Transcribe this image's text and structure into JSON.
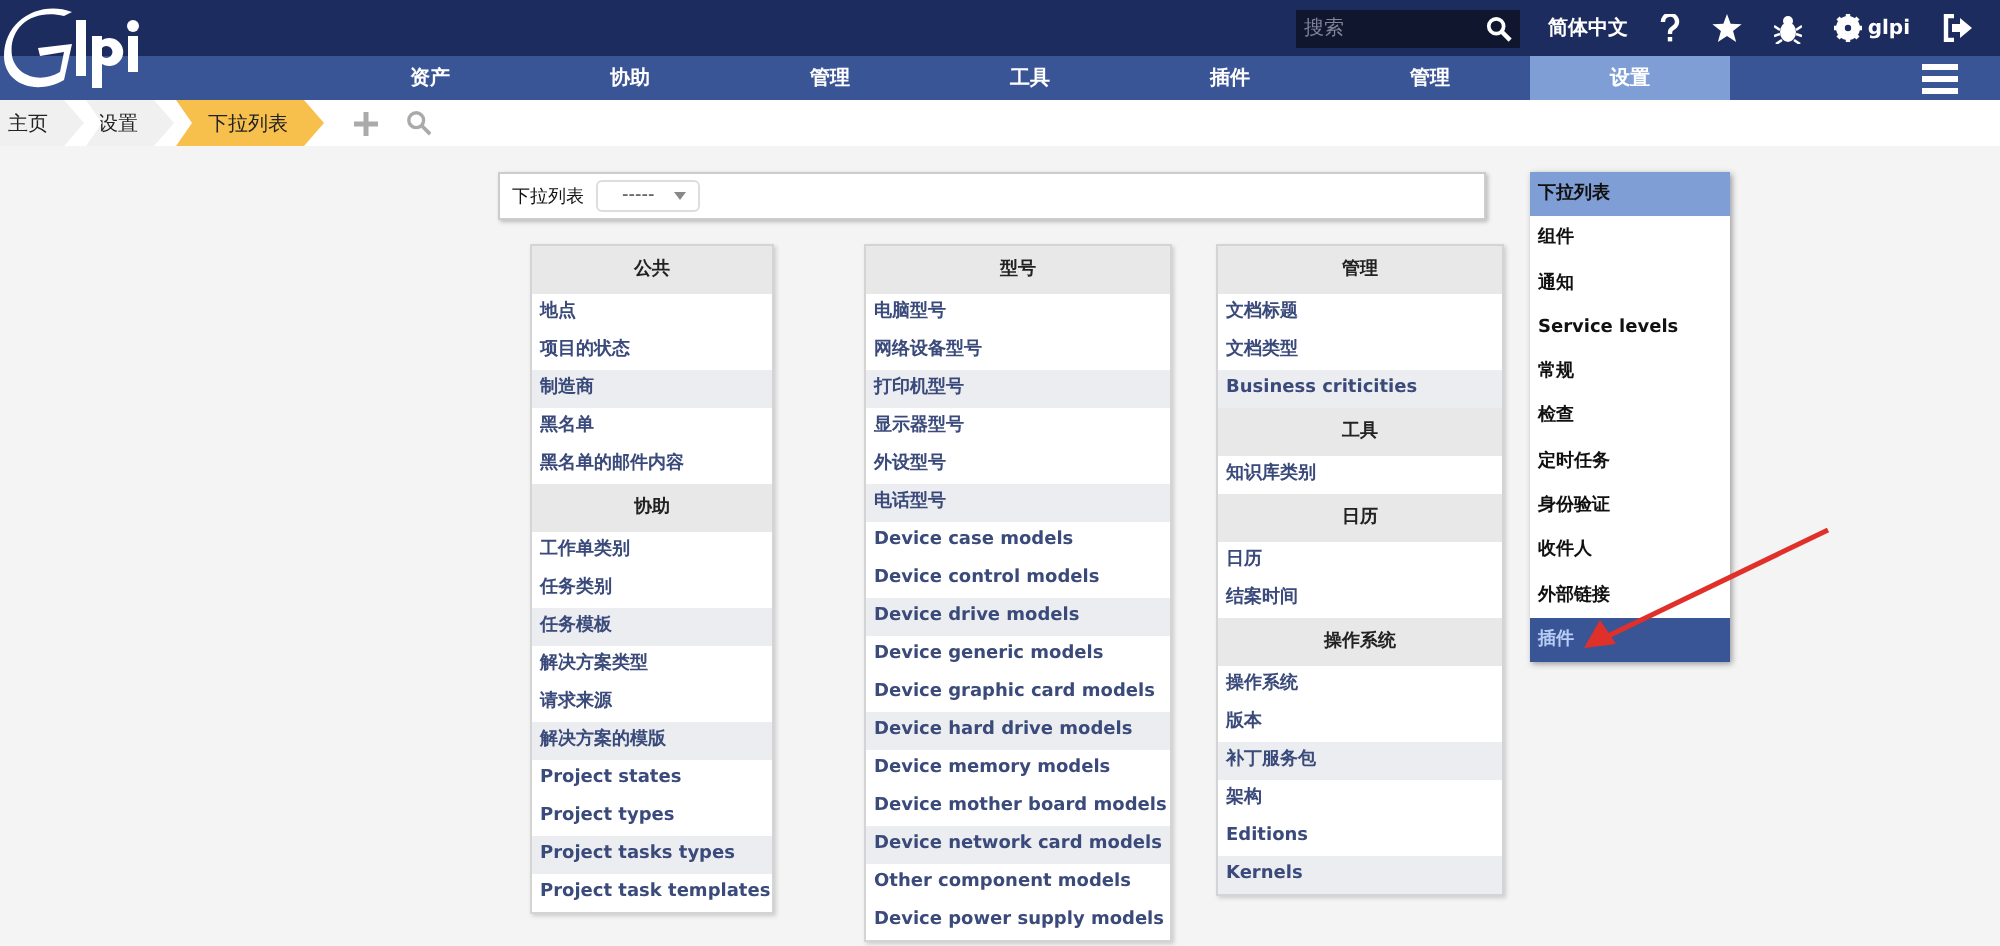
{
  "header": {
    "search": {
      "placeholder": "搜索"
    },
    "language": "简体中文",
    "user": "glpi"
  },
  "nav": [
    {
      "label": "资产",
      "selected": false
    },
    {
      "label": "协助",
      "selected": false
    },
    {
      "label": "管理",
      "selected": false
    },
    {
      "label": "工具",
      "selected": false
    },
    {
      "label": "插件",
      "selected": false
    },
    {
      "label": "管理",
      "selected": false
    },
    {
      "label": "设置",
      "selected": true
    }
  ],
  "breadcrumbs": [
    {
      "label": "主页",
      "selected": false
    },
    {
      "label": "设置",
      "selected": false
    },
    {
      "label": "下拉列表",
      "selected": true
    }
  ],
  "dropdown_panel": {
    "label": "下拉列表",
    "value": "-----"
  },
  "columns": [
    {
      "sections": [
        {
          "title": "公共",
          "items": [
            "地点",
            "项目的状态",
            "制造商",
            "黑名单",
            "黑名单的邮件内容"
          ]
        },
        {
          "title": "协助",
          "items": [
            "工作单类别",
            "任务类别",
            "任务模板",
            "解决方案类型",
            "请求来源",
            "解决方案的模版",
            "Project states",
            "Project types",
            "Project tasks types",
            "Project task templates"
          ]
        }
      ]
    },
    {
      "sections": [
        {
          "title": "型号",
          "items": [
            "电脑型号",
            "网络设备型号",
            "打印机型号",
            "显示器型号",
            "外设型号",
            "电话型号",
            "Device case models",
            "Device control models",
            "Device drive models",
            "Device generic models",
            "Device graphic card models",
            "Device hard drive models",
            "Device memory models",
            "Device mother board models",
            "Device network card models",
            "Other component models",
            "Device power supply models"
          ]
        }
      ]
    },
    {
      "sections": [
        {
          "title": "管理",
          "items": [
            "文档标题",
            "文档类型",
            "Business criticities"
          ]
        },
        {
          "title": "工具",
          "items": [
            "知识库类别"
          ]
        },
        {
          "title": "日历",
          "items": [
            "日历",
            "结案时间"
          ]
        },
        {
          "title": "操作系统",
          "items": [
            "操作系统",
            "版本",
            "补丁服务包",
            "架构",
            "Editions",
            "Kernels"
          ]
        }
      ]
    }
  ],
  "menu": [
    {
      "label": "下拉列表",
      "selected": true,
      "hovered": false
    },
    {
      "label": "组件",
      "selected": false,
      "hovered": false
    },
    {
      "label": "通知",
      "selected": false,
      "hovered": false
    },
    {
      "label": "Service levels",
      "selected": false,
      "hovered": false
    },
    {
      "label": "常规",
      "selected": false,
      "hovered": false
    },
    {
      "label": "检查",
      "selected": false,
      "hovered": false
    },
    {
      "label": "定时任务",
      "selected": false,
      "hovered": false
    },
    {
      "label": "身份验证",
      "selected": false,
      "hovered": false
    },
    {
      "label": "收件人",
      "selected": false,
      "hovered": false
    },
    {
      "label": "外部链接",
      "selected": false,
      "hovered": false
    },
    {
      "label": "插件",
      "selected": false,
      "hovered": true
    }
  ]
}
